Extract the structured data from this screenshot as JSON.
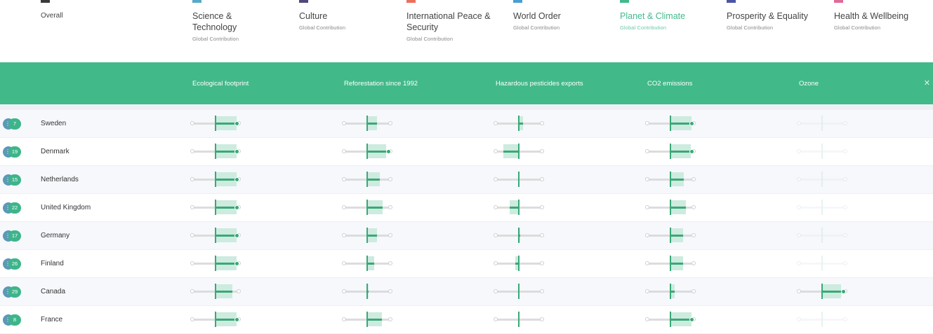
{
  "categories": [
    {
      "label": "Overall",
      "sub": "",
      "color": "#3a3a3a",
      "active": false
    },
    {
      "label": "Science & Technology",
      "sub": "Global Contribution",
      "color": "#58a8c8",
      "active": false
    },
    {
      "label": "Culture",
      "sub": "Global Contribution",
      "color": "#4f4a7a",
      "active": false
    },
    {
      "label": "International Peace & Security",
      "sub": "Global Contribution",
      "color": "#ec6f5b",
      "active": false
    },
    {
      "label": "World Order",
      "sub": "Global Contribution",
      "color": "#4a9ed4",
      "active": false
    },
    {
      "label": "Planet & Climate",
      "sub": "Global Contribution",
      "color": "#43b98c",
      "active": true
    },
    {
      "label": "Prosperity & Equality",
      "sub": "Global Contribution",
      "color": "#4b55a5",
      "active": false
    },
    {
      "label": "Health & Wellbeing",
      "sub": "Global Contribution",
      "color": "#e06a98",
      "active": false
    }
  ],
  "indicators": [
    "Ecological footprint",
    "Reforestation since 1992",
    "Hazardous pesticides exports",
    "CO2 emissions",
    "Ozone"
  ],
  "close_icon": "close-icon",
  "accent": "#42b989",
  "rows": [
    {
      "rank": "7",
      "country": "Sweden",
      "metrics": [
        {
          "v": 0.95,
          "b": 0.95
        },
        {
          "v": 0.45,
          "b": 0.45
        },
        {
          "v": 0.2,
          "b": 0.2
        },
        {
          "v": 0.95,
          "b": 0.95
        },
        {
          "v": 0.0,
          "b": 0.0,
          "faded": true
        }
      ]
    },
    {
      "rank": "19",
      "country": "Denmark",
      "metrics": [
        {
          "v": 0.95,
          "b": 0.95
        },
        {
          "v": 0.95,
          "b": 0.85
        },
        {
          "v": -0.7,
          "b": -0.7
        },
        {
          "v": 0.95,
          "b": 0.9
        },
        {
          "v": 0.0,
          "b": 0.0,
          "faded": true
        }
      ]
    },
    {
      "rank": "15",
      "country": "Netherlands",
      "metrics": [
        {
          "v": 0.95,
          "b": 0.95
        },
        {
          "v": 0.55,
          "b": 0.55
        },
        {
          "v": 0.0,
          "b": 0.0
        },
        {
          "v": 0.6,
          "b": 0.6
        },
        {
          "v": 0.0,
          "b": 0.0,
          "faded": true
        }
      ]
    },
    {
      "rank": "22",
      "country": "United Kingdom",
      "metrics": [
        {
          "v": 0.95,
          "b": 0.95
        },
        {
          "v": 0.7,
          "b": 0.7
        },
        {
          "v": -0.4,
          "b": -0.4
        },
        {
          "v": 0.7,
          "b": 0.7
        },
        {
          "v": 0.0,
          "b": 0.0,
          "faded": true
        }
      ]
    },
    {
      "rank": "17",
      "country": "Germany",
      "metrics": [
        {
          "v": 0.95,
          "b": 0.95
        },
        {
          "v": 0.45,
          "b": 0.45
        },
        {
          "v": 0.05,
          "b": 0.05
        },
        {
          "v": 0.55,
          "b": 0.55
        },
        {
          "v": 0.0,
          "b": 0.0,
          "faded": true
        }
      ]
    },
    {
      "rank": "26",
      "country": "Finland",
      "metrics": [
        {
          "v": 0.95,
          "b": 0.95
        },
        {
          "v": 0.3,
          "b": 0.3
        },
        {
          "v": -0.15,
          "b": -0.15
        },
        {
          "v": 0.55,
          "b": 0.55
        },
        {
          "v": 0.0,
          "b": 0.0,
          "faded": true
        }
      ]
    },
    {
      "rank": "29",
      "country": "Canada",
      "metrics": [
        {
          "v": 0.75,
          "b": 0.75
        },
        {
          "v": 0.05,
          "b": 0.05
        },
        {
          "v": 0.0,
          "b": 0.0
        },
        {
          "v": 0.2,
          "b": 0.2
        },
        {
          "v": 0.95,
          "b": 0.85
        }
      ]
    },
    {
      "rank": "8",
      "country": "France",
      "metrics": [
        {
          "v": 0.95,
          "b": 0.95
        },
        {
          "v": 0.65,
          "b": 0.65
        },
        {
          "v": 0.0,
          "b": 0.0
        },
        {
          "v": 0.95,
          "b": 0.95
        },
        {
          "v": 0.0,
          "b": 0.0,
          "faded": true
        }
      ]
    }
  ]
}
